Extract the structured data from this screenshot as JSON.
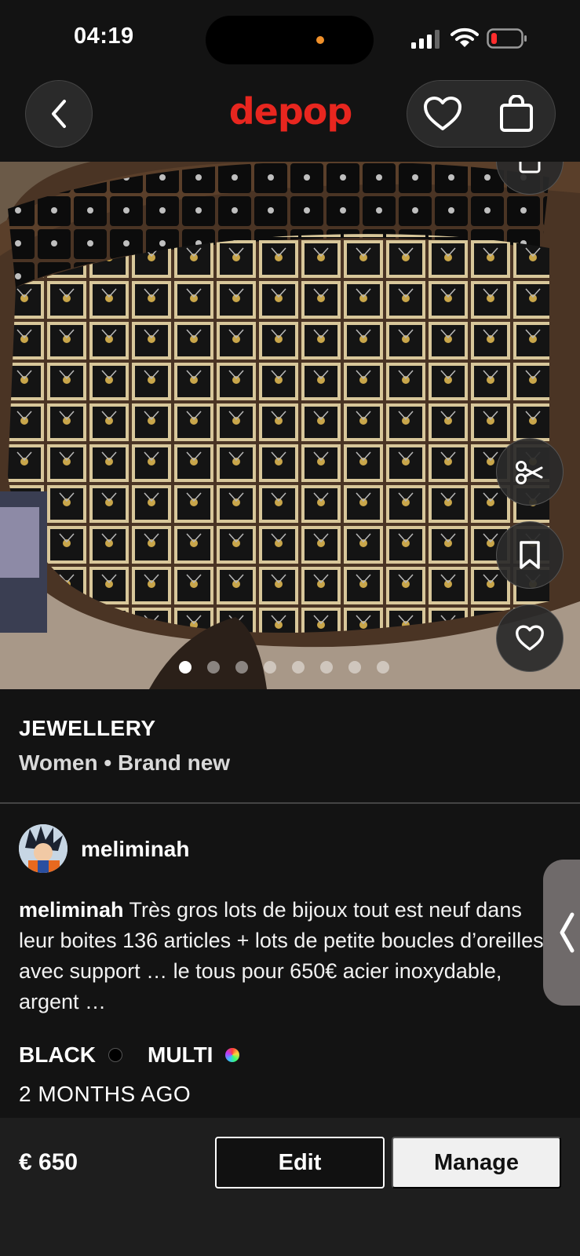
{
  "status_bar": {
    "time": "04:19"
  },
  "header": {
    "logo_text": "depop",
    "logo_color": "#e8261f"
  },
  "photo": {
    "slide_count": 8,
    "active_index": 0
  },
  "listing": {
    "category": "JEWELLERY",
    "subline": "Women • Brand new",
    "seller": "meliminah",
    "description_author": "meliminah",
    "description_text": " Très gros  lots de bijoux tout est neuf dans leur boites 136 articles + lots de petite boucles d’oreilles avec support … le tous pour 650€ acier inoxydable, argent …",
    "colors": [
      {
        "label": "BLACK",
        "swatch": "#000000"
      },
      {
        "label": "MULTI",
        "swatch": "multicolor"
      }
    ],
    "posted": "2 MONTHS AGO"
  },
  "footer": {
    "price": "€ 650",
    "edit_label": "Edit",
    "manage_label": "Manage"
  }
}
